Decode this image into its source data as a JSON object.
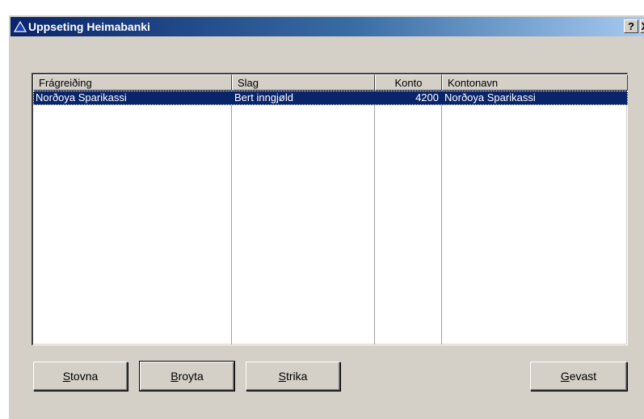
{
  "window": {
    "title": "Uppseting Heimabanki",
    "help_label": "?",
    "close_label": "X"
  },
  "list": {
    "columns": [
      "Frágreiðing",
      "Slag",
      "Konto",
      "Kontonavn"
    ],
    "rows": [
      [
        "Norðoya Sparikassi",
        "Bert inngjøld",
        "4200",
        "Norðoya Sparikassi"
      ]
    ],
    "selected_row": 0
  },
  "buttons": {
    "stovna": {
      "mnemonic": "S",
      "rest": "tovna"
    },
    "broyta": {
      "mnemonic": "B",
      "rest": "royta"
    },
    "strika": {
      "mnemonic": "S",
      "rest": "trika"
    },
    "gevast": {
      "mnemonic": "G",
      "rest": "evast"
    }
  },
  "colors": {
    "title_start": "#0a246a",
    "title_end": "#a6caf0",
    "face": "#d4d0c8",
    "selection": "#0a246a"
  }
}
